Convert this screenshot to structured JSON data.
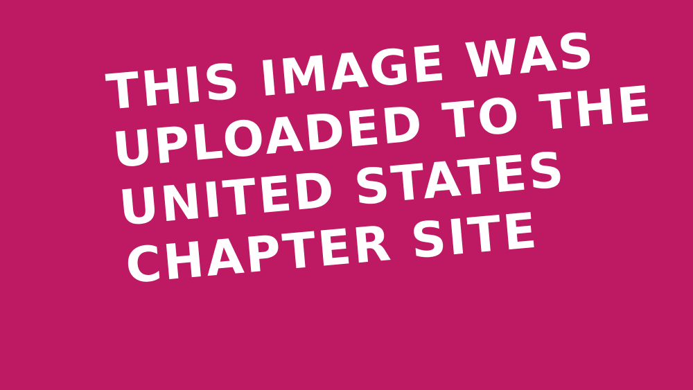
{
  "banner": {
    "background_color": "#BE1A63",
    "text_color": "#FFFFFF",
    "lines": [
      "THIS IMAGE WAS",
      "UPLOADED TO THE",
      "UNITED STATES",
      "CHAPTER SITE"
    ]
  }
}
